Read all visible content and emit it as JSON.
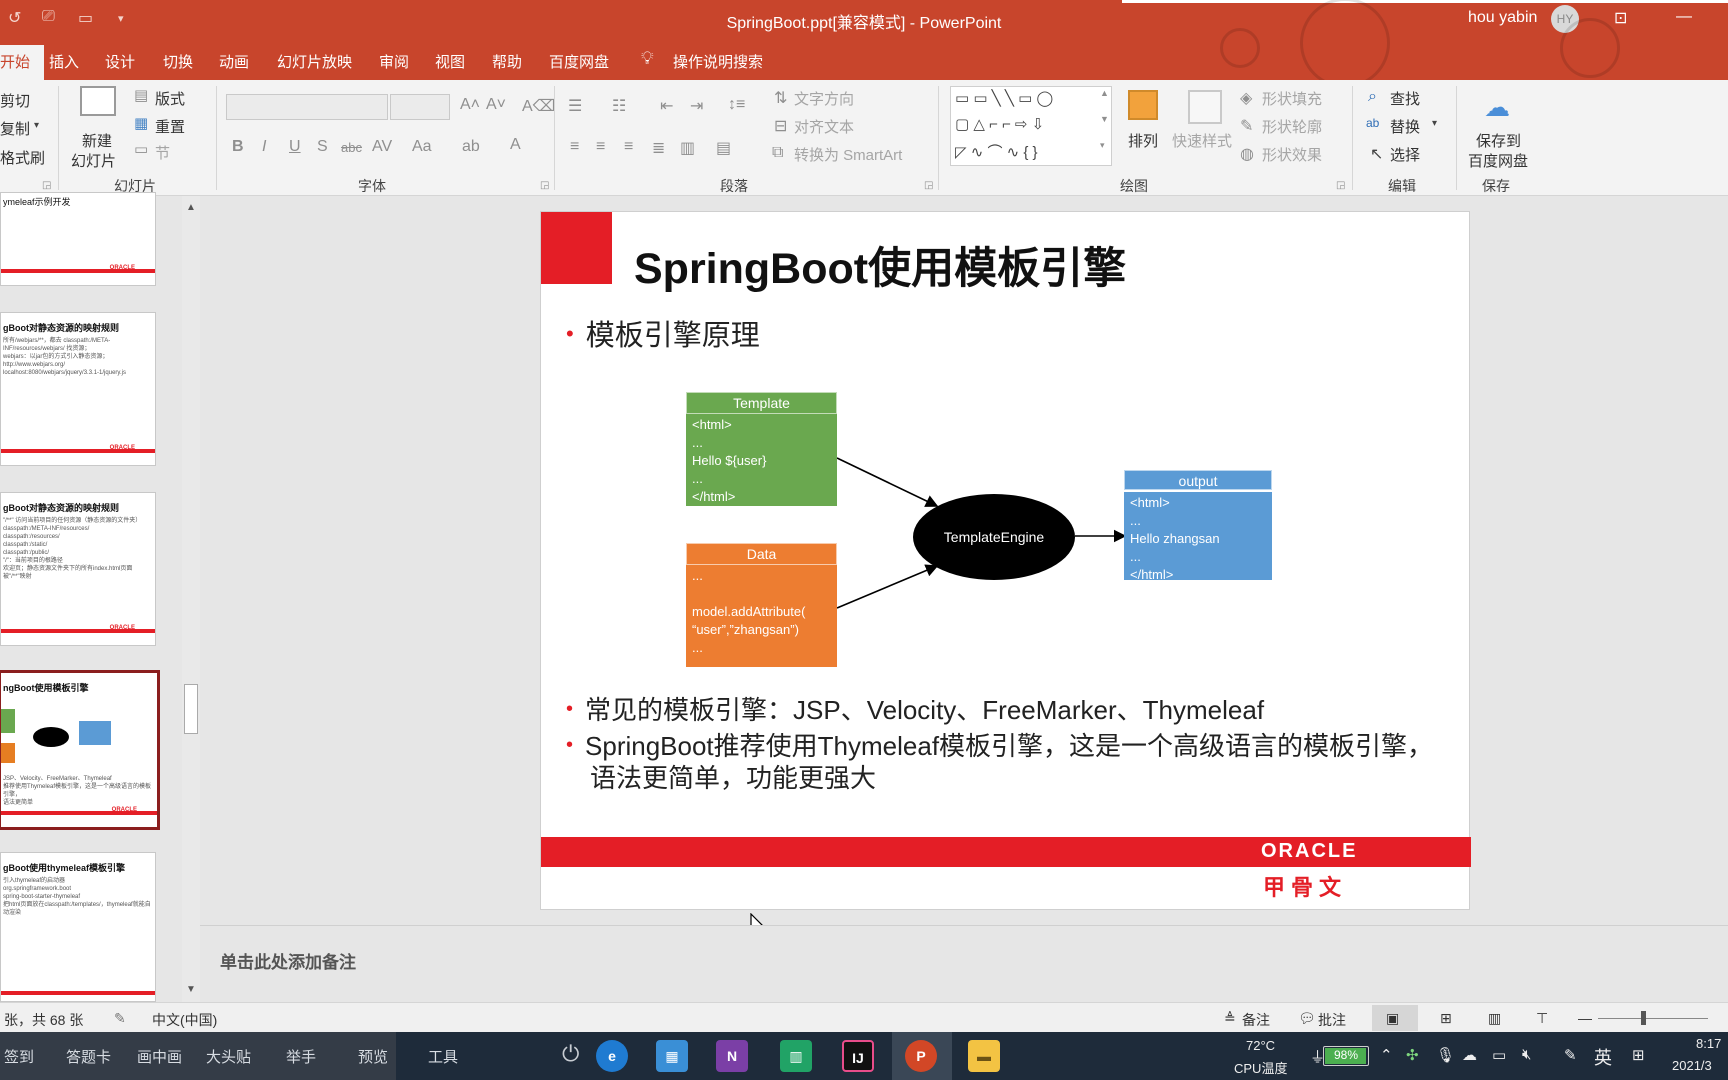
{
  "titlebar": {
    "title": "SpringBoot.ppt[兼容模式] - PowerPoint",
    "user": "hou yabin",
    "avatar": "HY",
    "quick_access_icons": [
      "undo-icon",
      "present-icon",
      "open-folder-icon",
      "customize-icon"
    ]
  },
  "tabs": [
    {
      "label": "开始"
    },
    {
      "label": "插入"
    },
    {
      "label": "设计"
    },
    {
      "label": "切换"
    },
    {
      "label": "动画"
    },
    {
      "label": "幻灯片放映"
    },
    {
      "label": "审阅"
    },
    {
      "label": "视图"
    },
    {
      "label": "帮助"
    },
    {
      "label": "百度网盘"
    }
  ],
  "search_tab": "操作说明搜索",
  "ribbon": {
    "clipboard": {
      "cut": "剪切",
      "copy": "复制",
      "format_painter": "格式刷"
    },
    "slides": {
      "new_slide_line1": "新建",
      "new_slide_line2": "幻灯片",
      "layout": "版式",
      "reset": "重置",
      "section": "节",
      "group": "幻灯片"
    },
    "font": {
      "group": "字体"
    },
    "paragraph": {
      "text_direction": "文字方向",
      "align_text": "对齐文本",
      "smartart": "转换为 SmartArt",
      "group": "段落"
    },
    "drawing": {
      "arrange": "排列",
      "quick_styles": "快速样式",
      "shape_fill": "形状填充",
      "shape_outline": "形状轮廓",
      "shape_effects": "形状效果",
      "group": "绘图"
    },
    "editing": {
      "find": "查找",
      "replace": "替换",
      "select": "选择",
      "group": "编辑"
    },
    "save": {
      "line1": "保存到",
      "line2": "百度网盘",
      "group": "保存"
    }
  },
  "thumbnails": [
    {
      "title": "ymeleaf示例开发"
    },
    {
      "title": "gBoot对静态资源的映射规则",
      "text": [
        "所有/webjars/**，都去 classpath:/META-INF/resources/webjars/ 找资源；",
        "webjars：以jar包的方式引入静态资源；",
        "http://www.webjars.org/",
        "localhost:8080/webjars/jquery/3.3.1-1/jquery.js"
      ]
    },
    {
      "title": "gBoot对静态资源的映射规则",
      "text": [
        "\"/**\" 访问当前项目的任何资源（静态资源的文件夹）",
        "classpath:/META-INF/resources/",
        "classpath:/resources/",
        "classpath:/static/",
        "classpath:/public/",
        "\"/\"：当前项目的根路径",
        "欢迎页；静态资源文件夹下的所有index.html页面被\"/**\"映射"
      ]
    },
    {
      "title": "ngBoot使用模板引擎",
      "text": [
        "JSP、Velocity、FreeMarker、Thymeleaf",
        "推荐使用Thymeleaf模板引擎，这是一个高级语言的模板引擎，",
        "语法更简单"
      ]
    },
    {
      "title": "gBoot使用thymeleaf模板引擎",
      "text": [
        "引入thymeleaf的启动器",
        "org.springframework.boot",
        "spring-boot-starter-thymeleaf",
        "把html页面放在classpath:/templates/，thymeleaf就能自动渲染"
      ]
    }
  ],
  "slide": {
    "title": "SpringBoot使用模板引擎",
    "bullet1": "模板引擎原理",
    "bullet2": "常见的模板引擎：JSP、Velocity、FreeMarker、Thymeleaf",
    "bullet3_line1": "SpringBoot推荐使用Thymeleaf模板引擎，这是一个高级语言的模板引擎，",
    "bullet3_line2": "语法更简单，功能更强大",
    "footer_logo": "ORACLE",
    "footer_cn": "甲骨文",
    "diagram": {
      "template_header": "Template",
      "template_lines": [
        "<html>",
        "...",
        "Hello ${user}",
        "...",
        "</html>"
      ],
      "data_header": "Data",
      "data_lines": [
        "...",
        "",
        "model.addAttribute(",
        "“user”,”zhangsan”)",
        "..."
      ],
      "engine": "TemplateEngine",
      "output_header": "output",
      "output_lines": [
        "<html>",
        "...",
        "Hello zhangsan",
        "...",
        "</html>"
      ],
      "colors": {
        "template": "#6aa84f",
        "data": "#ed7d31",
        "output": "#5b9bd5"
      }
    }
  },
  "notes_placeholder": "单击此处添加备注",
  "statusbar": {
    "slide_count": "张，共 68 张",
    "language": "中文(中国)",
    "notes": "备注",
    "comments": "批注"
  },
  "taskbar": {
    "left_items": [
      "签到",
      "答题卡",
      "画中画",
      "大头贴",
      "举手",
      "预览",
      "工具"
    ],
    "apps": [
      "edge-icon",
      "app-store-icon",
      "onenote-icon",
      "excel-icon",
      "intellij-icon",
      "powerpoint-icon",
      "file-explorer-icon"
    ],
    "temperature": "72°C",
    "cpu_label": "CPU温度",
    "battery": "98%",
    "battery_level": 0.98,
    "ime": "英",
    "time": "8:17",
    "date": "2021/3"
  }
}
